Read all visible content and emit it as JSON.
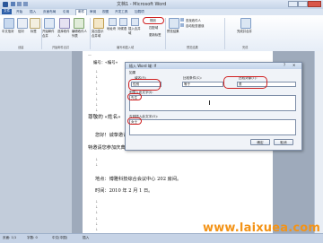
{
  "window": {
    "title": "文档1 - Microsoft Word"
  },
  "tabs": [
    "文件",
    "开始",
    "插入",
    "页面布局",
    "引用",
    "邮件",
    "审阅",
    "视图",
    "开发工具",
    "加载项"
  ],
  "ribbon": {
    "buttons": [
      "中文信封",
      "信封",
      "标签",
      "开始邮件合并",
      "选择收件人",
      "编辑收件人列表",
      "突出显示合并域",
      "地址块",
      "问候语",
      "插入合并域",
      "规则",
      "匹配域",
      "更新标签",
      "预览结果",
      "查找收件人",
      "自动检查错误",
      "完成并合并"
    ],
    "groups": [
      "创建",
      "开始邮件合并",
      "编写和插入域",
      "预览结果",
      "完成"
    ]
  },
  "document": {
    "line1": "编号：«编号»",
    "line2": "尊敬的 «姓名»",
    "line3": "您好！诚挚邀请您参加",
    "line4": "特邀请您参加庆典",
    "line5": "地点：博雅科技综合会议中心 202 房间。",
    "line6": "时间：2010 年 2 月 1 日。"
  },
  "dialog": {
    "title": "插入 Word 域: If",
    "section": "如果",
    "field_name_label": "域名(F):",
    "field_name_value": "性别",
    "comparison_label": "比较条件(C):",
    "comparison_value": "等于",
    "compare_to_label": "比较对象(T):",
    "compare_to_value": "男",
    "insert_text_label": "则插入此文字(I):",
    "insert_text_value": "先生",
    "else_text_label": "否则插入此文字(O):",
    "else_text_value": "女士",
    "ok": "确定",
    "cancel": "取消"
  },
  "status": {
    "page": "页面: 1/1",
    "words": "字数: 0",
    "lang": "中文(中国)",
    "mode": "插入"
  },
  "watermark": "www.laixuea.com"
}
